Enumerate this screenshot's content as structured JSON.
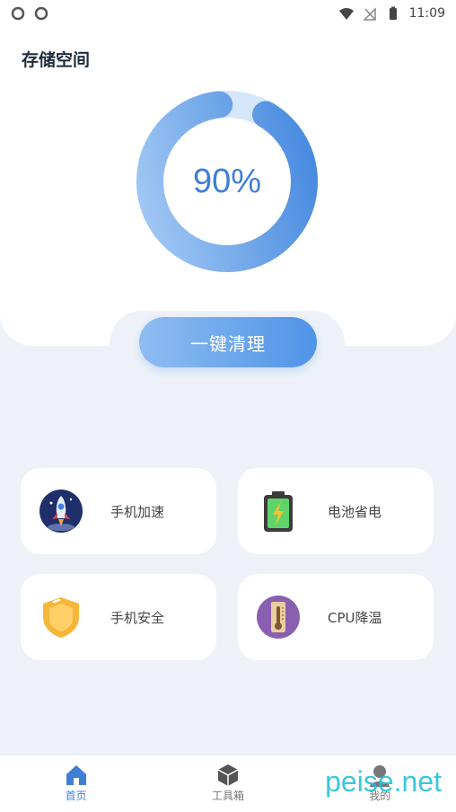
{
  "status_bar": {
    "time": "11:09"
  },
  "storage": {
    "title": "存储空间",
    "percent_label": "90%",
    "percent_value": 90
  },
  "clean_button": {
    "label": "一键清理"
  },
  "features": [
    {
      "label": "手机加速",
      "icon": "rocket-icon"
    },
    {
      "label": "电池省电",
      "icon": "battery-icon"
    },
    {
      "label": "手机安全",
      "icon": "shield-icon"
    },
    {
      "label": "CPU降温",
      "icon": "thermometer-icon"
    }
  ],
  "tabs": [
    {
      "label": "首页",
      "icon": "home-icon",
      "active": true
    },
    {
      "label": "工具箱",
      "icon": "toolbox-icon",
      "active": false
    },
    {
      "label": "我的",
      "icon": "profile-icon",
      "active": false
    }
  ],
  "watermark": "peise.net",
  "colors": {
    "accent": "#3f7fd6",
    "background": "#eef2f8",
    "watermark": "#25c1d9"
  }
}
